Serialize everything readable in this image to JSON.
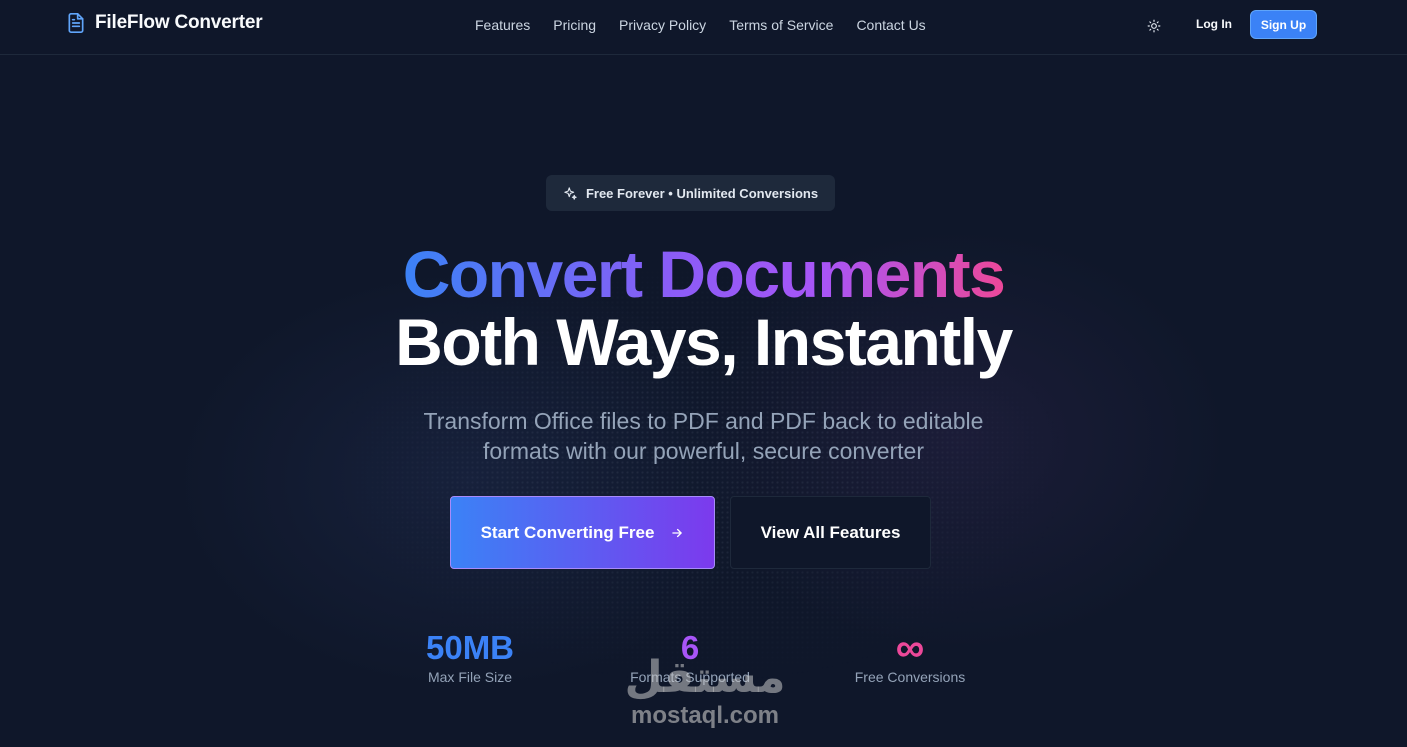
{
  "header": {
    "brand": "FileFlow Converter",
    "nav": [
      "Features",
      "Pricing",
      "Privacy Policy",
      "Terms of Service",
      "Contact Us"
    ],
    "login_label": "Log In",
    "signup_label": "Sign Up",
    "theme_icon": "sun-icon"
  },
  "hero": {
    "badge_text": "Free Forever • Unlimited Conversions",
    "badge_icon": "sparkles-icon",
    "title_line1": "Convert Documents",
    "title_line2": "Both Ways, Instantly",
    "subtitle_line1": "Transform Office files to PDF and PDF back to editable",
    "subtitle_line2": "formats with our powerful, secure converter",
    "primary_cta": "Start Converting Free",
    "secondary_cta": "View All Features"
  },
  "stats": [
    {
      "value": "50MB",
      "label": "Max File Size"
    },
    {
      "value": "6",
      "label": "Formats Supported"
    },
    {
      "value": "∞",
      "label": "Free Conversions"
    }
  ],
  "watermark": {
    "arabic": "مستقل",
    "latin": "mostaql.com"
  },
  "colors": {
    "background": "#0f172a",
    "accent_blue": "#3b82f6",
    "accent_purple": "#a855f7",
    "accent_pink": "#ec4899"
  }
}
